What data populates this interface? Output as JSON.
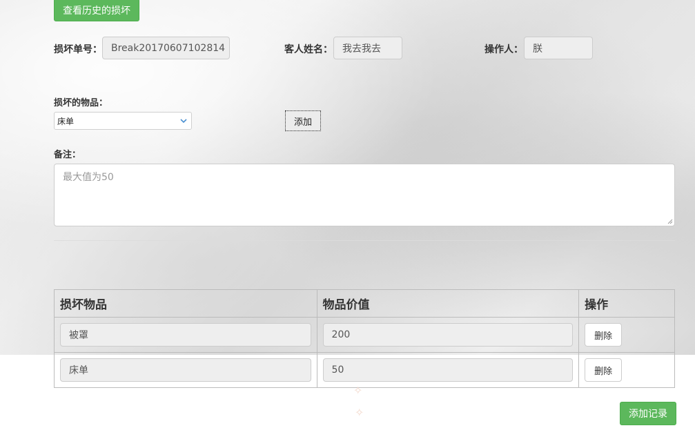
{
  "header": {
    "history_button": "查看历史的损坏"
  },
  "form": {
    "break_no_label": "损坏单号：",
    "break_no_value": "Break20170607102814",
    "guest_name_label": "客人姓名：",
    "guest_name_value": "我去我去",
    "operator_label": "操作人：",
    "operator_value": "朕",
    "item_label": "损坏的物品：",
    "item_selected": "床单",
    "add_button": "添加",
    "remark_label": "备注：",
    "remark_placeholder": "最大值为50"
  },
  "table": {
    "headers": [
      "损坏物品",
      "物品价值",
      "操作"
    ],
    "rows": [
      {
        "item": "被罩",
        "value": "200",
        "action": "删除"
      },
      {
        "item": "床单",
        "value": "50",
        "action": "删除"
      }
    ]
  },
  "footer": {
    "add_record_button": "添加记录"
  },
  "colors": {
    "primary_green": "#5cb85c",
    "readonly_bg": "#eeeeee"
  }
}
